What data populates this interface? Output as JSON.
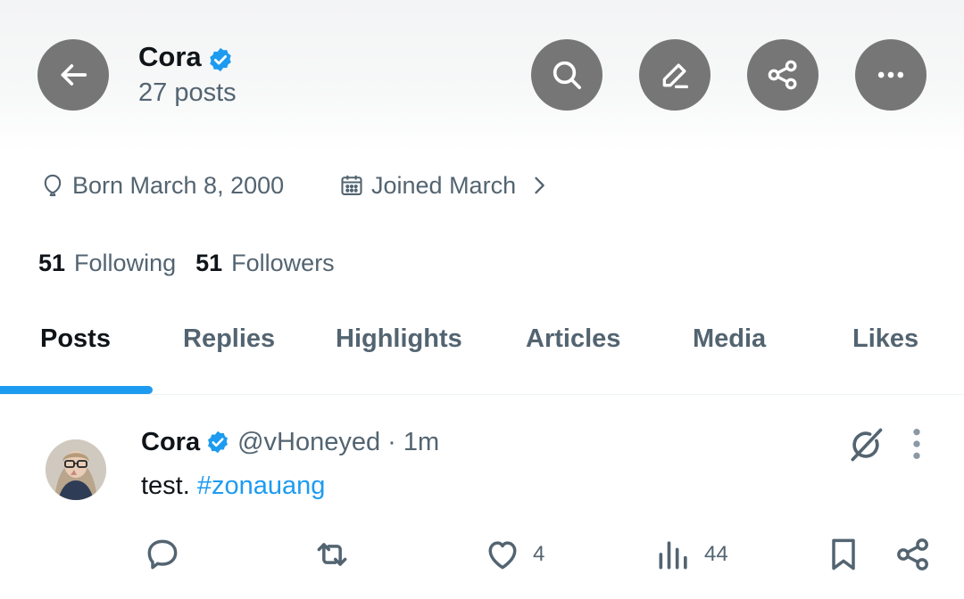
{
  "header": {
    "name": "Cora",
    "post_count": "27 posts",
    "icons": [
      "back-arrow-icon",
      "search-icon",
      "compose-icon",
      "share-icon",
      "more-horizontal-icon"
    ]
  },
  "profile": {
    "birth": "Born March 8, 2000",
    "joined": "Joined March",
    "following_count": "51",
    "following_label": "Following",
    "followers_count": "51",
    "followers_label": "Followers"
  },
  "tabs": [
    {
      "label": "Posts",
      "active": true
    },
    {
      "label": "Replies",
      "active": false
    },
    {
      "label": "Highlights",
      "active": false
    },
    {
      "label": "Articles",
      "active": false
    },
    {
      "label": "Media",
      "active": false
    },
    {
      "label": "Likes",
      "active": false
    }
  ],
  "post": {
    "name": "Cora",
    "handle": "@vHoneyed",
    "time": "· 1m",
    "text": "test.",
    "hashtag": "#zonauang",
    "likes": "4",
    "views": "44"
  },
  "colors": {
    "accent": "#1d9bf0",
    "secondary_text": "#536471",
    "primary_text": "#0f1419",
    "button_gray": "#767676"
  }
}
